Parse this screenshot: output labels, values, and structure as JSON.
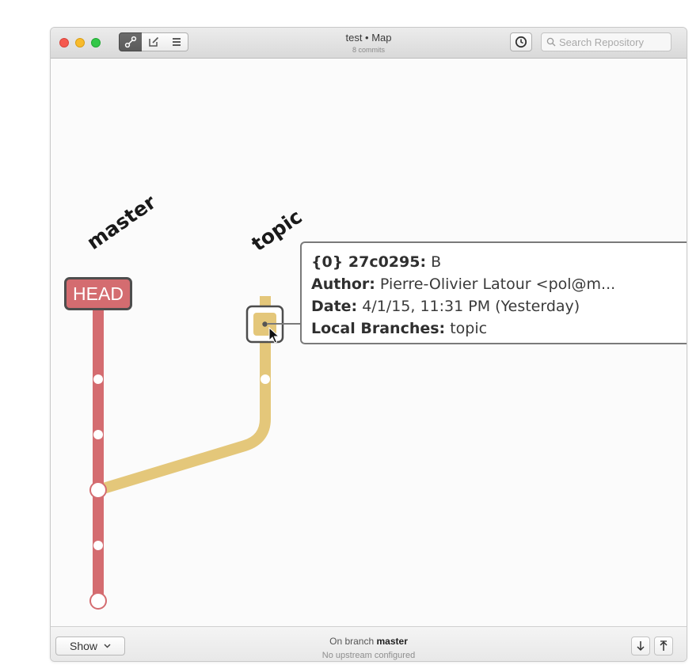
{
  "window": {
    "title": "test • Map",
    "subtitle": "8 commits"
  },
  "toolbar": {
    "view_modes": [
      "map-icon",
      "edit-icon",
      "list-icon"
    ],
    "active_view": "map",
    "search_placeholder": "Search Repository"
  },
  "map": {
    "branches": [
      {
        "name": "master",
        "color": "#d46c70"
      },
      {
        "name": "topic",
        "color": "#e4c77a"
      }
    ],
    "head_label": "HEAD",
    "tooltip": {
      "line1_bold": "{0} 27c0295:",
      "line1_text": "B",
      "author_label": "Author:",
      "author_value": "Pierre-Olivier Latour <pol@m...",
      "date_label": "Date:",
      "date_value": "4/1/15, 11:31 PM (Yesterday)",
      "branches_label": "Local Branches:",
      "branches_value": "topic"
    }
  },
  "status": {
    "show_label": "Show",
    "branch_prefix": "On branch",
    "branch_name": "master",
    "upstream": "No upstream configured"
  },
  "colors": {
    "master": "#d46c70",
    "topic": "#e4c77a",
    "head_border": "#4d4d4d"
  }
}
